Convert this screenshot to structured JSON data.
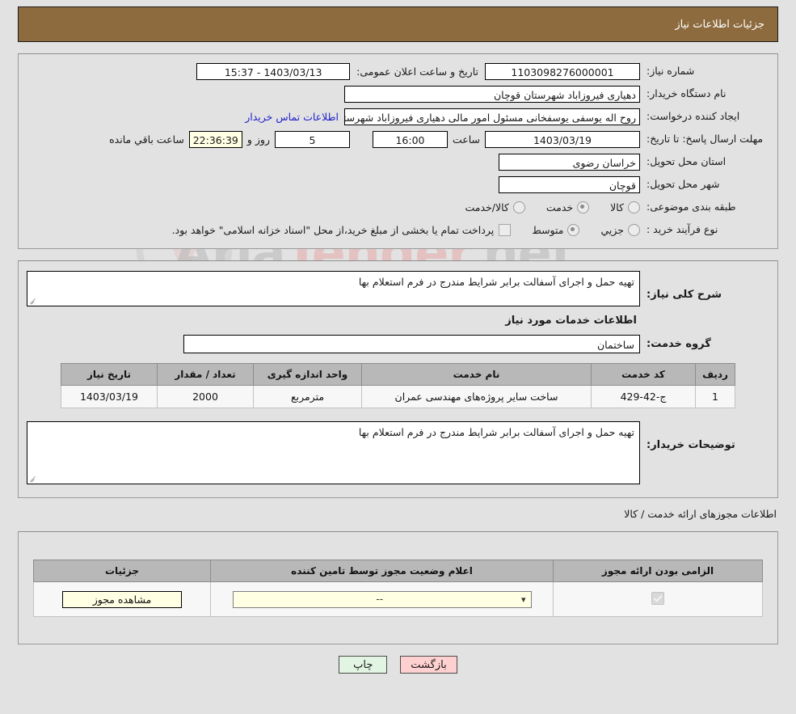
{
  "header": {
    "title": "جزئیات اطلاعات نیاز"
  },
  "form": {
    "need_number_label": "شماره نیاز:",
    "need_number": "1103098276000001",
    "announce_label": "تاریخ و ساعت اعلان عمومی:",
    "announce_value": "1403/03/13 - 15:37",
    "org_label": "نام دستگاه خریدار:",
    "org_value": "دهیاری فیروزاباد شهرستان قوچان",
    "creator_label": "ایجاد کننده درخواست:",
    "creator_value": "روح اله یوسفی یوسفخانی مسئول امور مالی دهیاری فیروزاباد شهرستان قوچان",
    "contact_link": "اطلاعات تماس خریدار",
    "deadline_label": "مهلت ارسال پاسخ: تا تاریخ:",
    "deadline_date": "1403/03/19",
    "time_label": "ساعت",
    "deadline_time": "16:00",
    "days_value": "5",
    "days_label": "روز و",
    "countdown": "22:36:39",
    "countdown_label": "ساعت باقي مانده",
    "province_label": "استان محل تحویل:",
    "province_value": "خراسان رضوی",
    "city_label": "شهر محل تحویل:",
    "city_value": "قوچان",
    "category_label": "طبقه بندی موضوعی:",
    "category_options": [
      {
        "label": "کالا",
        "selected": false
      },
      {
        "label": "خدمت",
        "selected": true
      },
      {
        "label": "کالا/خدمت",
        "selected": false
      }
    ],
    "process_label": "نوع فرآیند خرید :",
    "process_options": [
      {
        "label": "جزیي",
        "selected": false
      },
      {
        "label": "متوسط",
        "selected": true
      }
    ],
    "treasury_note": "پرداخت تمام یا بخشی از مبلغ خرید،از محل \"اسناد خزانه اسلامی\" خواهد بود."
  },
  "middle": {
    "overview_label": "شرح کلی نیاز:",
    "overview_value": "تهیه حمل و اجرای آسفالت برابر شرایط مندرج در فرم استعلام بها",
    "services_section_title": "اطلاعات خدمات مورد نیاز",
    "service_group_label": "گروه خدمت:",
    "service_group_value": "ساختمان",
    "services_table": {
      "columns": [
        "ردیف",
        "کد خدمت",
        "نام خدمت",
        "واحد اندازه گیری",
        "تعداد / مقدار",
        "تاریخ نیاز"
      ],
      "rows": [
        {
          "row": "1",
          "code": "ج-42-429",
          "name": "ساخت سایر پروژه‌های مهندسی عمران",
          "unit": "مترمربع",
          "quantity": "2000",
          "need_date": "1403/03/19"
        }
      ]
    },
    "buyer_notes_label": "توضیحات خریدار:",
    "buyer_notes_value": "تهیه حمل و اجرای آسفالت برابر شرایط مندرج در فرم استعلام بها"
  },
  "licenses": {
    "section_label": "اطلاعات مجوزهای ارائه خدمت / کالا",
    "columns": [
      "الزامی بودن ارائه مجوز",
      "اعلام وضعیت مجوز توسط تامین کننده",
      "جزئیات"
    ],
    "rows": [
      {
        "required": true,
        "status_value": "--",
        "details_button": "مشاهده مجوز"
      }
    ]
  },
  "footer": {
    "back_label": "بازگشت",
    "print_label": "چاپ"
  },
  "watermark": {
    "text_a": "Ariа",
    "text_b": "Tender",
    "text_c": ".net"
  },
  "colors": {
    "header_bar": "#8d6b3e",
    "page_bg": "#e2e2e2",
    "link": "#2222cc",
    "table_header": "#b8b8b8",
    "back_button": "#ffd0d0",
    "print_button": "#e2f5e2",
    "cream_field": "#ffffe4"
  }
}
